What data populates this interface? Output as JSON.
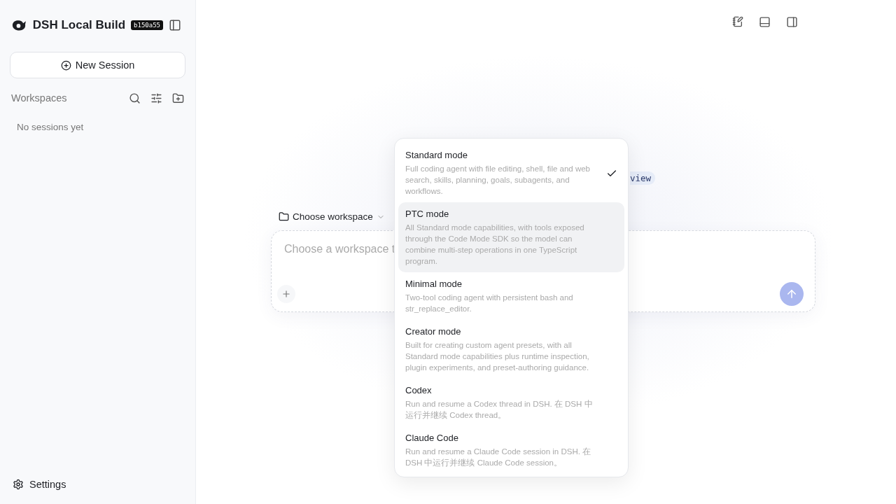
{
  "sidebar": {
    "app_name": "DSH Local Build",
    "build_tag": "b150a55",
    "new_session": "New Session",
    "section_title": "Workspaces",
    "empty_text": "No sessions yet",
    "settings": "Settings"
  },
  "main": {
    "badge": "view",
    "workspace_picker": "Choose workspace",
    "composer": {
      "placeholder": "Choose a workspace t"
    }
  },
  "mode_menu": [
    {
      "title": "Standard mode",
      "description": "Full coding agent with file editing, shell, file and web search, skills, planning, goals, subagents, and workflows.",
      "selected": true,
      "highlighted": false
    },
    {
      "title": "PTC mode",
      "description": "All Standard mode capabilities, with tools exposed through the Code Mode SDK so the model can combine multi-step operations in one TypeScript program.",
      "selected": false,
      "highlighted": true
    },
    {
      "title": "Minimal mode",
      "description": "Two-tool coding agent with persistent bash and str_replace_editor.",
      "selected": false,
      "highlighted": false
    },
    {
      "title": "Creator mode",
      "description": "Built for creating custom agent presets, with all Standard mode capabilities plus runtime inspection, plugin experiments, and preset-authoring guidance.",
      "selected": false,
      "highlighted": false
    },
    {
      "title": "Codex",
      "description": "Run and resume a Codex thread in DSH. 在 DSH 中运行并继续 Codex thread。",
      "selected": false,
      "highlighted": false
    },
    {
      "title": "Claude Code",
      "description": "Run and resume a Claude Code session in DSH. 在 DSH 中运行并继续 Claude Code session。",
      "selected": false,
      "highlighted": false
    }
  ]
}
